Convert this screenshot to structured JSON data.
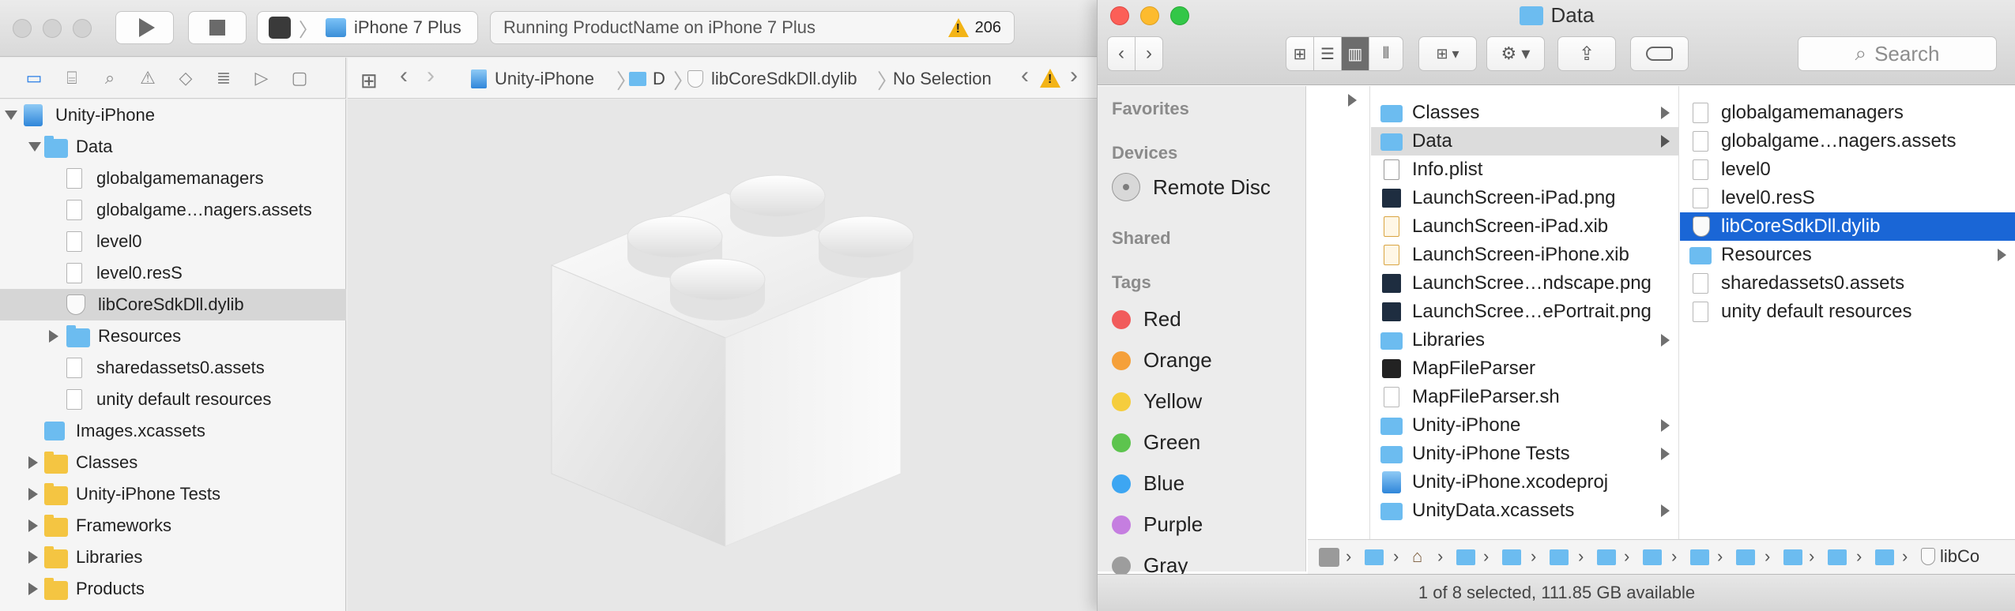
{
  "xcode": {
    "scheme": {
      "target": "",
      "device": "iPhone 7 Plus"
    },
    "activity": {
      "status": "Running ProductName on iPhone 7 Plus",
      "warning_count": "206"
    },
    "jump_bar": {
      "project": "Unity-iPhone",
      "folder": "D",
      "file": "libCoreSdkDll.dylib",
      "selection": "No Selection"
    },
    "navigator": {
      "items": [
        {
          "label": "Unity-iPhone",
          "kind": "project",
          "disclosure": "down",
          "indent": 0
        },
        {
          "label": "Data",
          "kind": "folder-blue",
          "disclosure": "down",
          "indent": 1
        },
        {
          "label": "globalgamemanagers",
          "kind": "file",
          "indent": 2
        },
        {
          "label": "globalgame…nagers.assets",
          "kind": "file",
          "indent": 2
        },
        {
          "label": "level0",
          "kind": "file",
          "indent": 2
        },
        {
          "label": "level0.resS",
          "kind": "file",
          "indent": 2
        },
        {
          "label": "libCoreSdkDll.dylib",
          "kind": "dylib",
          "indent": 2,
          "selected": true
        },
        {
          "label": "Resources",
          "kind": "folder-blue",
          "disclosure": "right",
          "indent": 2
        },
        {
          "label": "sharedassets0.assets",
          "kind": "file",
          "indent": 2
        },
        {
          "label": "unity default resources",
          "kind": "file",
          "indent": 2
        },
        {
          "label": "Images.xcassets",
          "kind": "xcassets",
          "indent": 1
        },
        {
          "label": "Classes",
          "kind": "folder-yellow",
          "disclosure": "right",
          "indent": 1
        },
        {
          "label": "Unity-iPhone Tests",
          "kind": "folder-yellow",
          "disclosure": "right",
          "indent": 1
        },
        {
          "label": "Frameworks",
          "kind": "folder-yellow",
          "disclosure": "right",
          "indent": 1
        },
        {
          "label": "Libraries",
          "kind": "folder-yellow",
          "disclosure": "right",
          "indent": 1
        },
        {
          "label": "Products",
          "kind": "folder-yellow",
          "disclosure": "right",
          "indent": 1
        }
      ]
    }
  },
  "finder": {
    "title": "Data",
    "search_placeholder": "Search",
    "sidebar": {
      "favorites_heading": "Favorites",
      "devices_heading": "Devices",
      "device": "Remote Disc",
      "shared_heading": "Shared",
      "tags_heading": "Tags",
      "tags": [
        {
          "label": "Red",
          "color": "#f15b5b"
        },
        {
          "label": "Orange",
          "color": "#f5a03a"
        },
        {
          "label": "Yellow",
          "color": "#f5cd3d"
        },
        {
          "label": "Green",
          "color": "#5dc44e"
        },
        {
          "label": "Blue",
          "color": "#3da6f2"
        },
        {
          "label": "Purple",
          "color": "#c57ee0"
        },
        {
          "label": "Gray",
          "color": "#9d9d9d"
        }
      ]
    },
    "column2": [
      {
        "label": "Classes",
        "icon": "folder",
        "arrow": true
      },
      {
        "label": "Data",
        "icon": "folder",
        "arrow": true,
        "selected": "gray"
      },
      {
        "label": "Info.plist",
        "icon": "plist"
      },
      {
        "label": "LaunchScreen-iPad.png",
        "icon": "dark"
      },
      {
        "label": "LaunchScreen-iPad.xib",
        "icon": "xib"
      },
      {
        "label": "LaunchScreen-iPhone.xib",
        "icon": "xib"
      },
      {
        "label": "LaunchScree…ndscape.png",
        "icon": "dark"
      },
      {
        "label": "LaunchScree…ePortrait.png",
        "icon": "dark"
      },
      {
        "label": "Libraries",
        "icon": "folder",
        "arrow": true
      },
      {
        "label": "MapFileParser",
        "icon": "term"
      },
      {
        "label": "MapFileParser.sh",
        "icon": "file"
      },
      {
        "label": "Unity-iPhone",
        "icon": "folder",
        "arrow": true
      },
      {
        "label": "Unity-iPhone Tests",
        "icon": "folder",
        "arrow": true
      },
      {
        "label": "Unity-iPhone.xcodeproj",
        "icon": "proj"
      },
      {
        "label": "UnityData.xcassets",
        "icon": "folder",
        "arrow": true
      }
    ],
    "column3": [
      {
        "label": "globalgamemanagers",
        "icon": "file"
      },
      {
        "label": "globalgame…nagers.assets",
        "icon": "file"
      },
      {
        "label": "level0",
        "icon": "file"
      },
      {
        "label": "level0.resS",
        "icon": "file"
      },
      {
        "label": "libCoreSdkDll.dylib",
        "icon": "dylib",
        "selected": "blue"
      },
      {
        "label": "Resources",
        "icon": "folder",
        "arrow": true
      },
      {
        "label": "sharedassets0.assets",
        "icon": "file"
      },
      {
        "label": "unity default resources",
        "icon": "file"
      }
    ],
    "path_end": "libCo",
    "status": "1 of 8 selected, 111.85 GB available"
  },
  "colors": {
    "accent": "#1a66d6",
    "folder": "#6cbcf0",
    "xcode_folder": "#f4c542",
    "warning": "#f3b416"
  }
}
